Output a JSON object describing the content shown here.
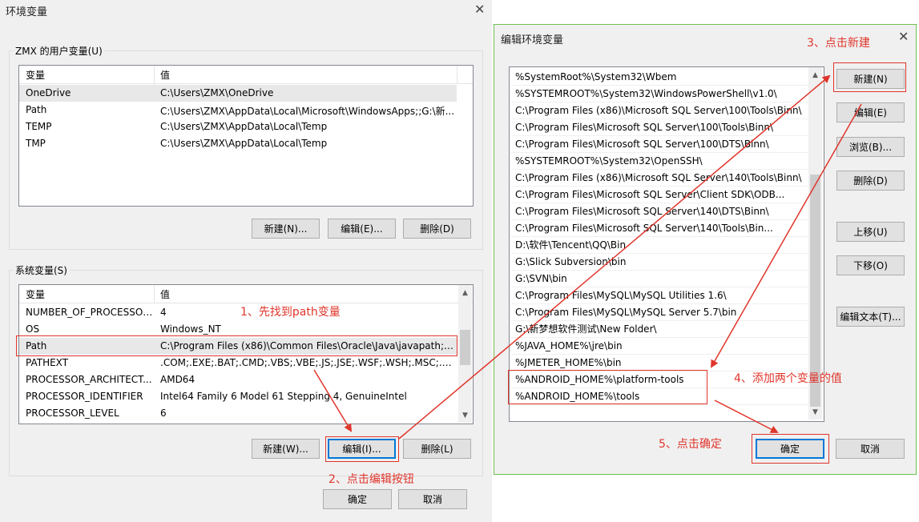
{
  "left_dialog": {
    "title": "环境变量",
    "user_group_label": "ZMX 的用户变量(U)",
    "system_group_label": "系统变量(S)",
    "col_var": "变量",
    "col_val": "值",
    "user_vars": [
      {
        "name": "OneDrive",
        "value": "C:\\Users\\ZMX\\OneDrive"
      },
      {
        "name": "Path",
        "value": "C:\\Users\\ZMX\\AppData\\Local\\Microsoft\\WindowsApps;;G:\\新..."
      },
      {
        "name": "TEMP",
        "value": "C:\\Users\\ZMX\\AppData\\Local\\Temp"
      },
      {
        "name": "TMP",
        "value": "C:\\Users\\ZMX\\AppData\\Local\\Temp"
      }
    ],
    "system_vars": [
      {
        "name": "NUMBER_OF_PROCESSORS",
        "value": "4"
      },
      {
        "name": "OS",
        "value": "Windows_NT"
      },
      {
        "name": "Path",
        "value": "C:\\Program Files (x86)\\Common Files\\Oracle\\Java\\javapath;%..."
      },
      {
        "name": "PATHEXT",
        "value": ".COM;.EXE;.BAT;.CMD;.VBS;.VBE;.JS;.JSE;.WSF;.WSH;.MSC;.PY;.P..."
      },
      {
        "name": "PROCESSOR_ARCHITECT...",
        "value": "AMD64"
      },
      {
        "name": "PROCESSOR_IDENTIFIER",
        "value": "Intel64 Family 6 Model 61 Stepping 4, GenuineIntel"
      },
      {
        "name": "PROCESSOR_LEVEL",
        "value": "6"
      }
    ],
    "user_buttons": {
      "new": "新建(N)...",
      "edit": "编辑(E)...",
      "delete": "删除(D)"
    },
    "system_buttons": {
      "new": "新建(W)...",
      "edit": "编辑(I)...",
      "delete": "删除(L)"
    },
    "ok": "确定",
    "cancel": "取消"
  },
  "right_dialog": {
    "title": "编辑环境变量",
    "paths": [
      "%SystemRoot%\\System32\\Wbem",
      "%SYSTEMROOT%\\System32\\WindowsPowerShell\\v1.0\\",
      "C:\\Program Files (x86)\\Microsoft SQL Server\\100\\Tools\\Binn\\",
      "C:\\Program Files\\Microsoft SQL Server\\100\\Tools\\Binn\\",
      "C:\\Program Files\\Microsoft SQL Server\\100\\DTS\\Binn\\",
      "%SYSTEMROOT%\\System32\\OpenSSH\\",
      "C:\\Program Files (x86)\\Microsoft SQL Server\\140\\Tools\\Binn\\",
      "C:\\Program Files\\Microsoft SQL Server\\Client SDK\\ODB...",
      "C:\\Program Files\\Microsoft SQL Server\\140\\DTS\\Binn\\",
      "C:\\Program Files\\Microsoft SQL Server\\140\\Tools\\Bin...",
      "D:\\软件\\Tencent\\QQ\\Bin",
      "G:\\Slick Subversion\\bin",
      "G:\\SVN\\bin",
      "C:\\Program Files\\MySQL\\MySQL Utilities 1.6\\",
      "C:\\Program Files\\MySQL\\MySQL Server 5.7\\bin",
      "G:\\新梦想软件测试\\New Folder\\",
      "%JAVA_HOME%\\jre\\bin",
      "%JMETER_HOME%\\bin",
      "%ANDROID_HOME%\\platform-tools",
      "%ANDROID_HOME%\\tools"
    ],
    "buttons": {
      "new": "新建(N)",
      "edit": "编辑(E)",
      "browse": "浏览(B)...",
      "delete": "删除(D)",
      "up": "上移(U)",
      "down": "下移(O)",
      "edit_text": "编辑文本(T)..."
    },
    "ok": "确定",
    "cancel": "取消"
  },
  "annotations": {
    "step1": "1、先找到path变量",
    "step2": "2、点击编辑按钮",
    "step3": "3、点击新建",
    "step4": "4、添加两个变量的值",
    "step5": "5、点击确定"
  },
  "colors": {
    "annotation": "#e0352b",
    "dialog_bg": "#f0f0f0",
    "focus_border": "#0078d7"
  }
}
